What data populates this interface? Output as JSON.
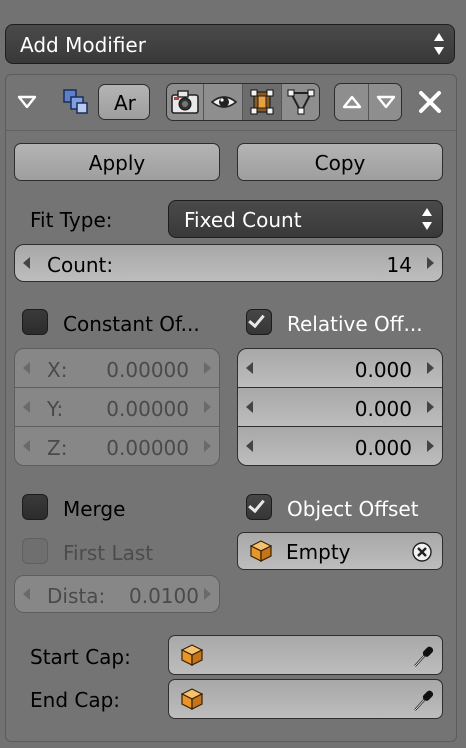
{
  "header": {
    "add_modifier": "Add Modifier"
  },
  "modifier": {
    "name": "Ar",
    "icons": [
      "render-camera-icon",
      "eye-icon",
      "editmode-vertex-icon",
      "cage-triangle-icon"
    ]
  },
  "actions": {
    "apply": "Apply",
    "copy": "Copy"
  },
  "fit": {
    "label": "Fit Type:",
    "value": "Fixed Count"
  },
  "count": {
    "label": "Count:",
    "value": "14"
  },
  "constant": {
    "label": "Constant Of...",
    "checked": false,
    "x_label": "X:",
    "x": "0.00000",
    "y_label": "Y:",
    "y": "0.00000",
    "z_label": "Z:",
    "z": "0.00000"
  },
  "relative": {
    "label": "Relative Off...",
    "checked": true,
    "x": "0.000",
    "y": "0.000",
    "z": "0.000"
  },
  "merge": {
    "label": "Merge",
    "checked": false
  },
  "first_last": {
    "label": "First Last",
    "checked": false
  },
  "distance": {
    "label": "Dista:",
    "value": "0.0100"
  },
  "object_offset": {
    "label": "Object Offset",
    "checked": true,
    "object": "Empty"
  },
  "caps": {
    "start_label": "Start Cap:",
    "end_label": "End Cap:"
  }
}
